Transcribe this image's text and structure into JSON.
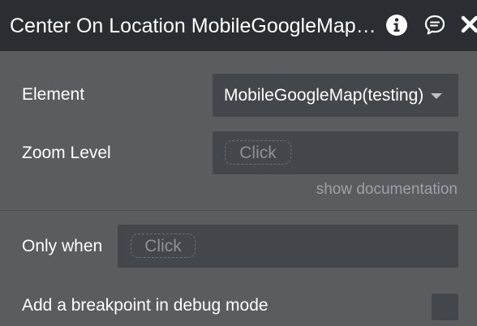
{
  "header": {
    "title": "Center On Location MobileGoogleMap (testing)",
    "icons": [
      "info-icon",
      "comment-icon",
      "close-icon"
    ]
  },
  "fields": {
    "element": {
      "label": "Element",
      "value": "MobileGoogleMap(testing)"
    },
    "zoom_level": {
      "label": "Zoom Level",
      "placeholder": "Click"
    },
    "show_documentation": "show documentation"
  },
  "conditions": {
    "only_when": {
      "label": "Only when",
      "placeholder": "Click"
    },
    "breakpoint": {
      "label": "Add a breakpoint in debug mode",
      "checked": false
    }
  },
  "colors": {
    "header_bg": "#2a2d31",
    "panel_bg": "#5a5c60",
    "field_bg": "#43464a",
    "text": "#ffffff",
    "muted": "#9da0a4"
  }
}
